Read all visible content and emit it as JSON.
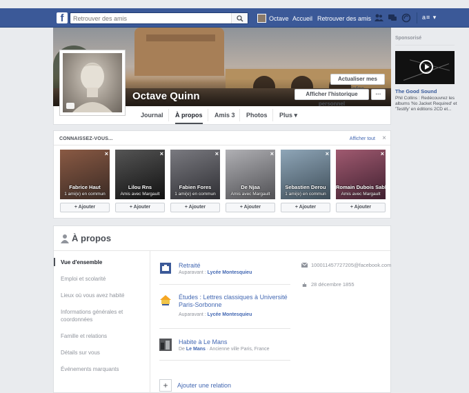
{
  "topbar": {
    "logo": "f",
    "search_placeholder": "Retrouver des amis",
    "user_name": "Octave",
    "home": "Accueil",
    "find_friends": "Retrouver des amis",
    "icons": [
      "friend-requests-icon",
      "messages-icon",
      "notifications-icon"
    ],
    "settings_label": "a≡ ▾"
  },
  "profile": {
    "name": "Octave Quinn",
    "update_info_label": "Actualiser mes infos",
    "activity_log_label": "Afficher l'historique personnel",
    "more_label": "···"
  },
  "tabs": [
    {
      "label": "Journal"
    },
    {
      "label": "À propos"
    },
    {
      "label": "Amis 3"
    },
    {
      "label": "Photos"
    },
    {
      "label": "Plus ▾"
    }
  ],
  "pymk": {
    "title": "CONNAISSEZ-VOUS...",
    "see_all": "Afficher tout",
    "close": "×",
    "add_label": "Ajouter",
    "people": [
      {
        "name": "Fabrice Haut",
        "common": "1 ami(e) en commun",
        "color": "#5a3f33"
      },
      {
        "name": "Lilou Rns",
        "common": "Amis avec Margault",
        "color": "#2a2a2a"
      },
      {
        "name": "Fabien Fores",
        "common": "1 ami(e) en commun",
        "color": "#4a4a4f"
      },
      {
        "name": "De Njaa",
        "common": "Amis avec Margault",
        "color": "#6c6c70"
      },
      {
        "name": "Sebastien Derou",
        "common": "1 ami(e) en commun",
        "color": "#5b6e7c"
      },
      {
        "name": "Romain Dubois Sable",
        "common": "Amis avec Margault",
        "color": "#6b3a4a"
      }
    ]
  },
  "about": {
    "title": "À propos",
    "sidebar": [
      "Vue d'ensemble",
      "Emploi et scolarité",
      "Lieux où vous avez habité",
      "Informations générales et coordonnées",
      "Famille et relations",
      "Détails sur vous",
      "Événements marquants"
    ],
    "entries": [
      {
        "title": "Retraité",
        "sub_prefix": "Auparavant :",
        "sub_link": "Lycée Montesquieu",
        "sub_rest": ""
      },
      {
        "title": "Études : Lettres classiques à Université Paris-Sorbonne",
        "sub_prefix": "Auparavant :",
        "sub_link": "Lycée Montesquieu",
        "sub_rest": ""
      },
      {
        "title": "Habite à Le Mans",
        "sub_prefix": "De",
        "sub_link": "Le Mans",
        "sub_rest": " · Ancienne ville Paris, France"
      }
    ],
    "contacts": [
      {
        "text": "100011457727205@facebook.com",
        "icon": "email-icon"
      },
      {
        "text": "28 décembre 1855",
        "icon": "birthday-icon"
      }
    ],
    "add_relation": "Ajouter une relation"
  },
  "sponsored": {
    "title": "Sponsorisé",
    "ad_name": "The Good Sound",
    "ad_desc": "Phil Collins : Redécouvrez les albums 'No Jacket Required' et 'Testify' en éditions 2CD et..."
  }
}
